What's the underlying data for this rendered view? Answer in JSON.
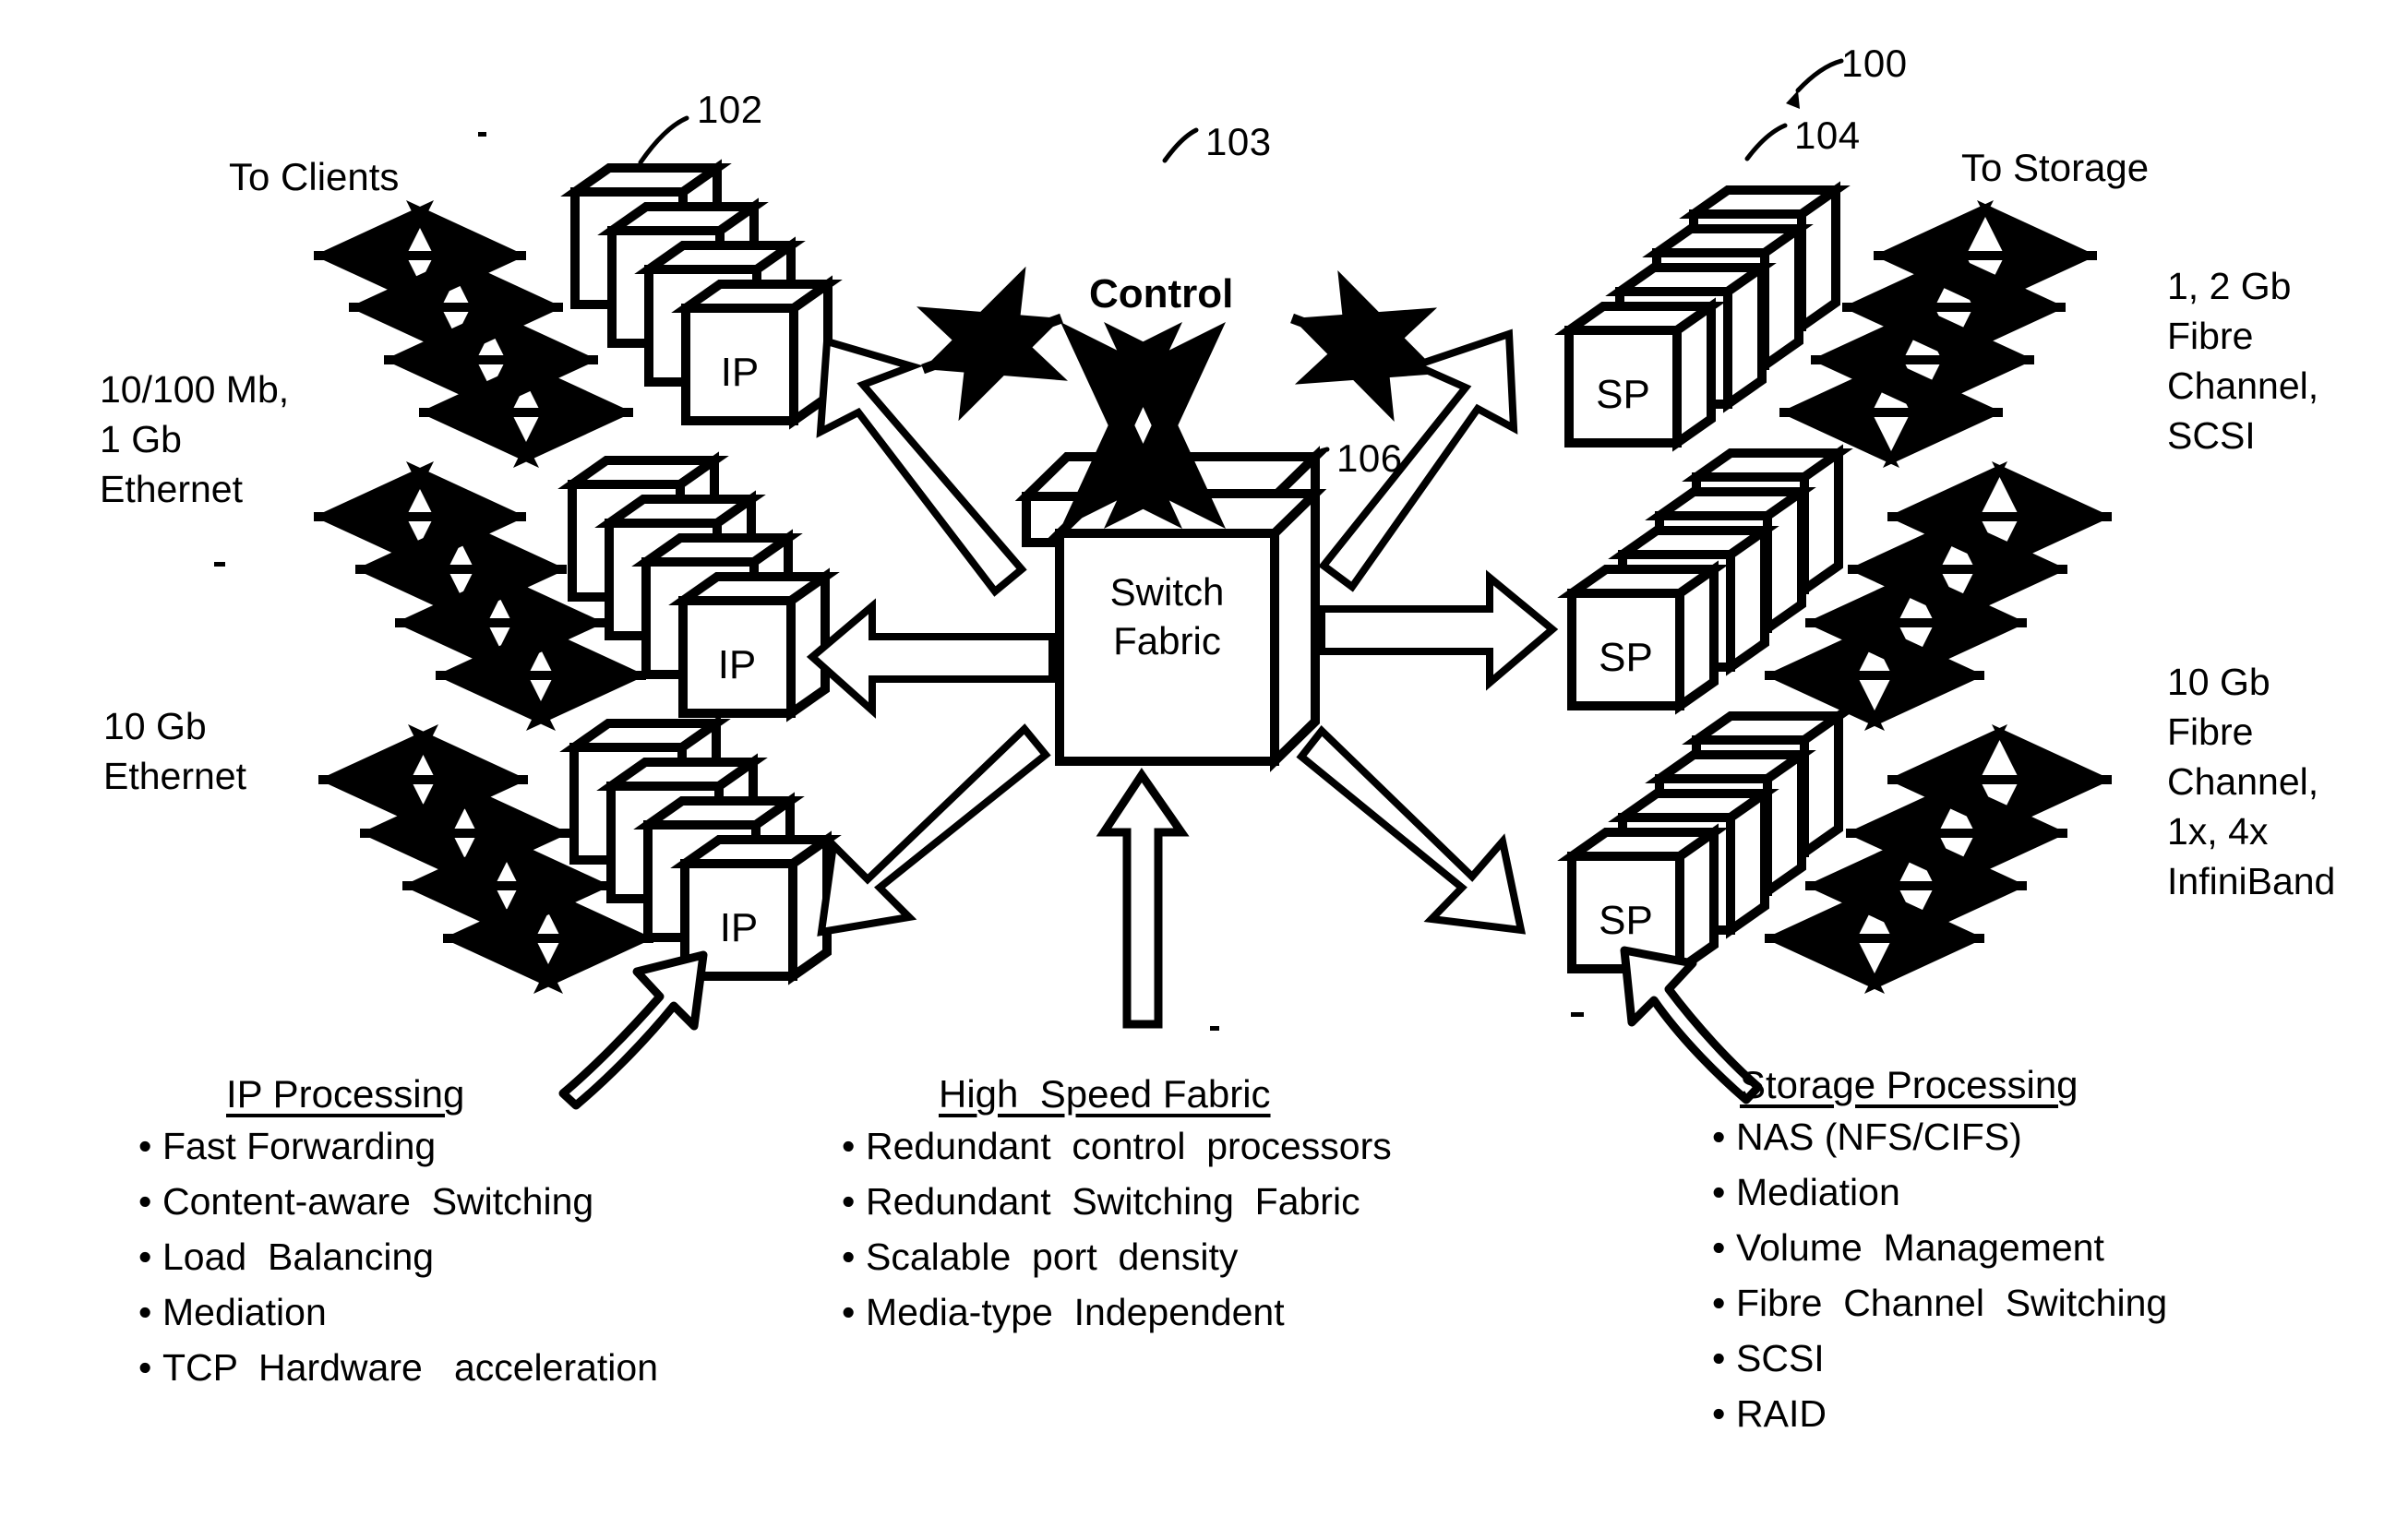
{
  "figure": {
    "ref_main": "100",
    "ref_ip_stack": "102",
    "ref_control": "103",
    "ref_sp_stack": "104",
    "ref_fabric": "106"
  },
  "headings": {
    "to_clients": "To Clients",
    "to_storage": "To Storage",
    "control": "Control"
  },
  "fabric": {
    "line1": "Switch",
    "line2": "Fabric"
  },
  "modules": {
    "ip_label": "IP",
    "sp_label": "SP"
  },
  "left_interfaces": [
    {
      "id": "ethernet-1g",
      "text": "10/100 Mb,\n1 Gb\nEthernet"
    },
    {
      "id": "ethernet-10g",
      "text": "10 Gb\nEthernet"
    }
  ],
  "right_interfaces": [
    {
      "id": "fibre-channel-scsi",
      "text": "1, 2 Gb\nFibre\nChannel,\nSCSI"
    },
    {
      "id": "fibre-channel-infiniband",
      "text": "10 Gb\nFibre\nChannel,\n1x, 4x\nInfiniBand"
    }
  ],
  "panels": {
    "ip_processing": {
      "title": "IP Processing",
      "items": [
        "Fast Forwarding",
        "Content-aware  Switching",
        "Load  Balancing",
        "Mediation",
        "TCP  Hardware   acceleration"
      ]
    },
    "high_speed_fabric": {
      "title": "High  Speed Fabric",
      "items": [
        "Redundant  control  processors",
        "Redundant  Switching  Fabric",
        "Scalable  port  density",
        "Media-type  Independent"
      ]
    },
    "storage_processing": {
      "title": "Storage Processing",
      "items": [
        "NAS (NFS/CIFS)",
        "Mediation",
        "Volume  Management",
        "Fibre  Channel  Switching",
        "SCSI",
        "RAID"
      ]
    }
  },
  "colors": {
    "ink": "#000000",
    "paper": "#ffffff"
  }
}
